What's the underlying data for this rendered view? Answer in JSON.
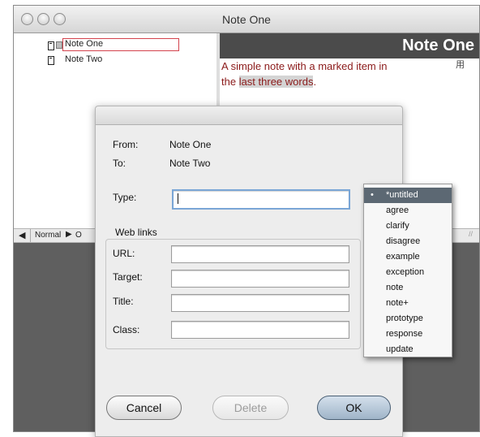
{
  "window": {
    "title": "Note One"
  },
  "outline": {
    "items": [
      {
        "label": "Note One"
      },
      {
        "label": "Note Two"
      }
    ]
  },
  "note_pane": {
    "title": "Note One",
    "text_line1": "A simple note with a marked item in",
    "text_line2_prefix": "the ",
    "text_highlight": "last three words",
    "text_suffix": ".",
    "side_glyph": "用"
  },
  "status_bar": {
    "style": "Normal",
    "style2_fragment": "O"
  },
  "dialog": {
    "from_label": "From:",
    "from_value": "Note One",
    "to_label": "To:",
    "to_value": "Note Two",
    "type_label": "Type:",
    "type_value": "",
    "web_links_label": "Web links",
    "url_label": "URL:",
    "target_label": "Target:",
    "title_label": "Title:",
    "class_label": "Class:",
    "url_value": "",
    "target_value": "",
    "title_value": "",
    "class_value": "",
    "cancel_label": "Cancel",
    "delete_label": "Delete",
    "ok_label": "OK"
  },
  "type_popup": {
    "selected": "*untitled",
    "options": [
      "*untitled",
      "agree",
      "clarify",
      "disagree",
      "example",
      "exception",
      "note",
      "note+",
      "prototype",
      "response",
      "update"
    ]
  },
  "colors": {
    "note_text": "#8b1a1a",
    "selection_outline": "#d3434d",
    "popup_selected": "#5c6873",
    "note_header": "#4b4b4b"
  }
}
